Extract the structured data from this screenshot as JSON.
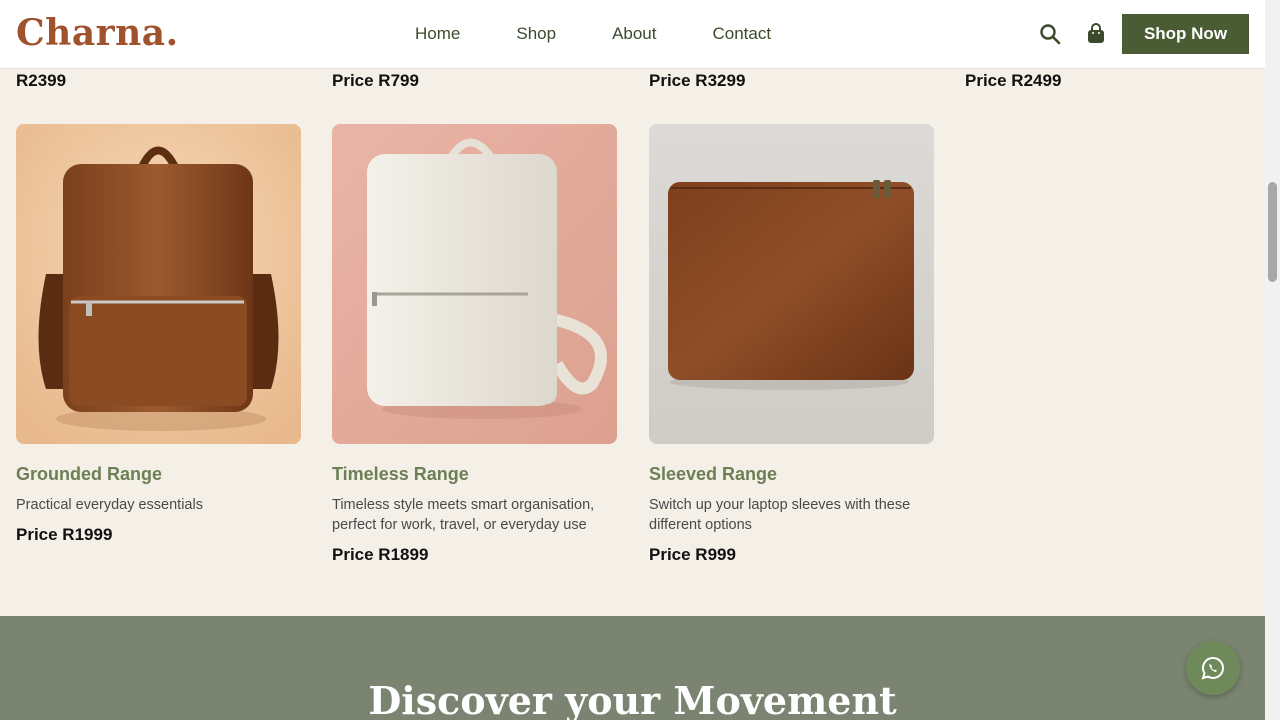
{
  "brand": {
    "logo": "Charna."
  },
  "nav": {
    "items": [
      "Home",
      "Shop",
      "About",
      "Contact"
    ]
  },
  "header": {
    "shop_button": "Shop Now",
    "search_icon": "search-icon",
    "cart_icon": "shopping-bag-icon"
  },
  "top_prices": [
    "R2399",
    "Price R799",
    "Price R3299",
    "Price R2499"
  ],
  "products": [
    {
      "title": "Grounded Range",
      "desc": "Practical everyday essentials",
      "price": "Price R1999",
      "image": "brown-leather-backpack",
      "bg": "#efc9a3"
    },
    {
      "title": "Timeless Range",
      "desc": "Timeless style meets smart organisation, perfect for work, travel, or everyday use",
      "price": "Price R1899",
      "image": "cream-leather-backpack",
      "bg": "#e3ab9c"
    },
    {
      "title": "Sleeved Range",
      "desc": "Switch up your laptop sleeves with these different options",
      "price": "Price R999",
      "image": "brown-laptop-sleeve",
      "bg": "#d6d3cf"
    }
  ],
  "discover": {
    "heading": "Discover your Movement"
  },
  "whatsapp": {
    "icon": "whatsapp-icon"
  },
  "colors": {
    "accent": "#4a5c34",
    "logo": "#a0522d",
    "title_green": "#6d7f55",
    "page_bg": "#f4efe7",
    "band": "#7a8470"
  }
}
